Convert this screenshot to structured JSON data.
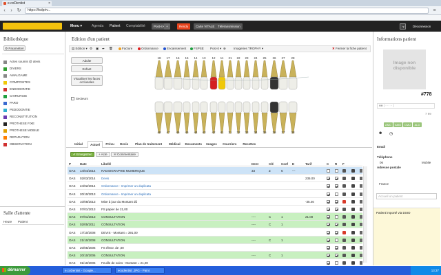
{
  "browser": {
    "tab_title": "e.coDentist",
    "url": "https://fsdpriv..."
  },
  "app": {
    "menu_label": "Menu",
    "nav": [
      "Agenda",
      "Patient",
      "Comptabilité"
    ],
    "post_it": "Post-it",
    "urgent": "Rendu",
    "carte_vitale": "Carte VITALE",
    "teletransmission": "Téléransmission",
    "help": "?",
    "logout": "Déconnexion"
  },
  "left": {
    "title": "Bibliothèque",
    "param": "Paramétrer",
    "categories": [
      {
        "label": "Actes soumis @ devis",
        "color": "#888888"
      },
      {
        "label": "DIVERS",
        "color": "#2f9e2f"
      },
      {
        "label": "AMALGAME",
        "color": "#888888"
      },
      {
        "label": "COMPOSITES",
        "color": "#f0c808"
      },
      {
        "label": "ENDODONTIE",
        "color": "#d03030"
      },
      {
        "label": "CHIRURGIE",
        "color": "#20a040"
      },
      {
        "label": "PARO",
        "color": "#3a6ad0"
      },
      {
        "label": "PEDODONTIE",
        "color": "#30b0d0"
      },
      {
        "label": "RECONSTITUTION",
        "color": "#6a3ab0"
      },
      {
        "label": "PROTHESE FIXE",
        "color": "#222222"
      },
      {
        "label": "PROTHESE MOBILE",
        "color": "#e0a000"
      },
      {
        "label": "REPARATION",
        "color": "#ff7f00"
      },
      {
        "label": "OBSERVATION",
        "color": "#d03030"
      }
    ],
    "waiting_title": "Salle d'attente",
    "waiting_cols": [
      "Heure",
      "Patient"
    ]
  },
  "center": {
    "title": "Edition d'un patient",
    "toolbar": [
      "Edition",
      "Facture",
      "Ordonnance",
      "Encaissement",
      "FSPSE",
      "Post-it",
      "Imageries TROPHY"
    ],
    "toolbar_colors": {
      "facture": "#f0a020",
      "ordonnance": "#e02020",
      "encaissement": "#2050d0",
      "fspse": "#20a040"
    },
    "close_patient": "Fermer la fiche patient",
    "modes": [
      "Adulte",
      "Enfant"
    ],
    "visualise": "Visualiser les faces occlusales",
    "secteurs": "Secteurs",
    "upper_numbers": [
      "18",
      "17",
      "16",
      "15",
      "14",
      "13",
      "12",
      "11",
      "21",
      "22",
      "23",
      "24",
      "25",
      "26",
      "27",
      "28"
    ],
    "lower_numbers": [
      "48",
      "47",
      "46",
      "45",
      "44",
      "43",
      "42",
      "41",
      "31",
      "32",
      "33",
      "34",
      "35",
      "36",
      "37",
      "38"
    ],
    "tabs": [
      "Initial",
      "Actuel",
      "Prévu",
      "Devis",
      "Plan de traitement",
      "Médical",
      "Documents",
      "Images",
      "Courriers",
      "Recettes"
    ],
    "active_tab": "Actuel",
    "btn_save": "Enregistrer",
    "btn_act": "Acte",
    "btn_comment": "Commentaire",
    "columns": [
      "P",
      "Date",
      "Libellé",
      "Dent",
      "Clé",
      "Coef",
      "D",
      "Tarif",
      "C",
      "R",
      "F"
    ],
    "rows": [
      {
        "p": "OAS",
        "date": "14/04/2014",
        "label": "RADIOGRAPHIE NUMERIQUE",
        "dent": "33",
        "cle": "Z",
        "coef": "6",
        "d": "---",
        "tarif": "",
        "style": "sel"
      },
      {
        "p": "OAS",
        "date": "02/03/2014",
        "label": "Devis",
        "dent": "",
        "cle": "",
        "coef": "",
        "d": "",
        "tarif": "235.00",
        "style": "link"
      },
      {
        "p": "OAS",
        "date": "24/02/2014",
        "label": "Ordonnance - Imprimer un duplicata",
        "dent": "",
        "cle": "",
        "coef": "",
        "d": "",
        "tarif": "",
        "style": "link"
      },
      {
        "p": "OAS",
        "date": "20/10/2013",
        "label": "Ordonnance - Imprimer un duplicata",
        "dent": "",
        "cle": "",
        "coef": "",
        "d": "",
        "tarif": "",
        "style": "link"
      },
      {
        "p": "OAS",
        "date": "10/08/2013",
        "label": "Mise à jour du Montant dû",
        "dent": "",
        "cle": "",
        "coef": "",
        "d": "",
        "tarif": "-35.46",
        "style": "plain"
      },
      {
        "p": "OAS",
        "date": "07/01/2013",
        "label": "FS papier de 21,00",
        "dent": "",
        "cle": "",
        "coef": "",
        "d": "",
        "tarif": "",
        "style": "plain"
      },
      {
        "p": "OAS",
        "date": "07/01/2013",
        "label": "CONSULTATION",
        "dent": "----",
        "cle": "C",
        "coef": "1",
        "d": "",
        "tarif": "21.00",
        "style": "green"
      },
      {
        "p": "OAS",
        "date": "02/05/2011",
        "label": "CONSULTATION",
        "dent": "----",
        "cle": "C",
        "coef": "1",
        "d": "",
        "tarif": "",
        "style": "green"
      },
      {
        "p": "OAS",
        "date": "17/10/2008",
        "label": "DEVIS - Montant = 391,00",
        "dent": "",
        "cle": "",
        "coef": "",
        "d": "",
        "tarif": "",
        "style": "plain"
      },
      {
        "p": "OAS",
        "date": "21/10/2008",
        "label": "CONSULTATION",
        "dent": "----",
        "cle": "C",
        "coef": "1",
        "d": "",
        "tarif": "",
        "style": "green"
      },
      {
        "p": "OAS",
        "date": "20/05/2006",
        "label": "FS électr. de ,00",
        "dent": "",
        "cle": "",
        "coef": "",
        "d": "",
        "tarif": "",
        "style": "plain"
      },
      {
        "p": "OAS",
        "date": "20/10/2006",
        "label": "CONSULTATION",
        "dent": "----",
        "cle": "C",
        "coef": "1",
        "d": "",
        "tarif": "",
        "style": "green"
      },
      {
        "p": "OAS",
        "date": "01/10/2006",
        "label": "Feuille de soins - Montant = 21,00",
        "dent": "",
        "cle": "",
        "coef": "",
        "d": "",
        "tarif": "",
        "style": "plain"
      }
    ]
  },
  "right": {
    "title": "Informations patient",
    "photo": "Image non disponible",
    "patient_id": "#778",
    "age": "7 99",
    "badges": [
      "AMC",
      "AMO",
      "CMU",
      "ALD"
    ],
    "email_label": "Email",
    "phone_label": "Téléphone",
    "phone_pre": "06",
    "mobile": "Mobile",
    "address_label": "Adresse postale",
    "country": "France",
    "search_placeholder": "Accueil un patient",
    "note": "Patient importé via DSIO"
  },
  "taskbar": {
    "start": "démarrer",
    "tasks": [
      "e.coDentist - Google...",
      "ecodentist .JPG - Paint"
    ],
    "clock": "13:37"
  }
}
